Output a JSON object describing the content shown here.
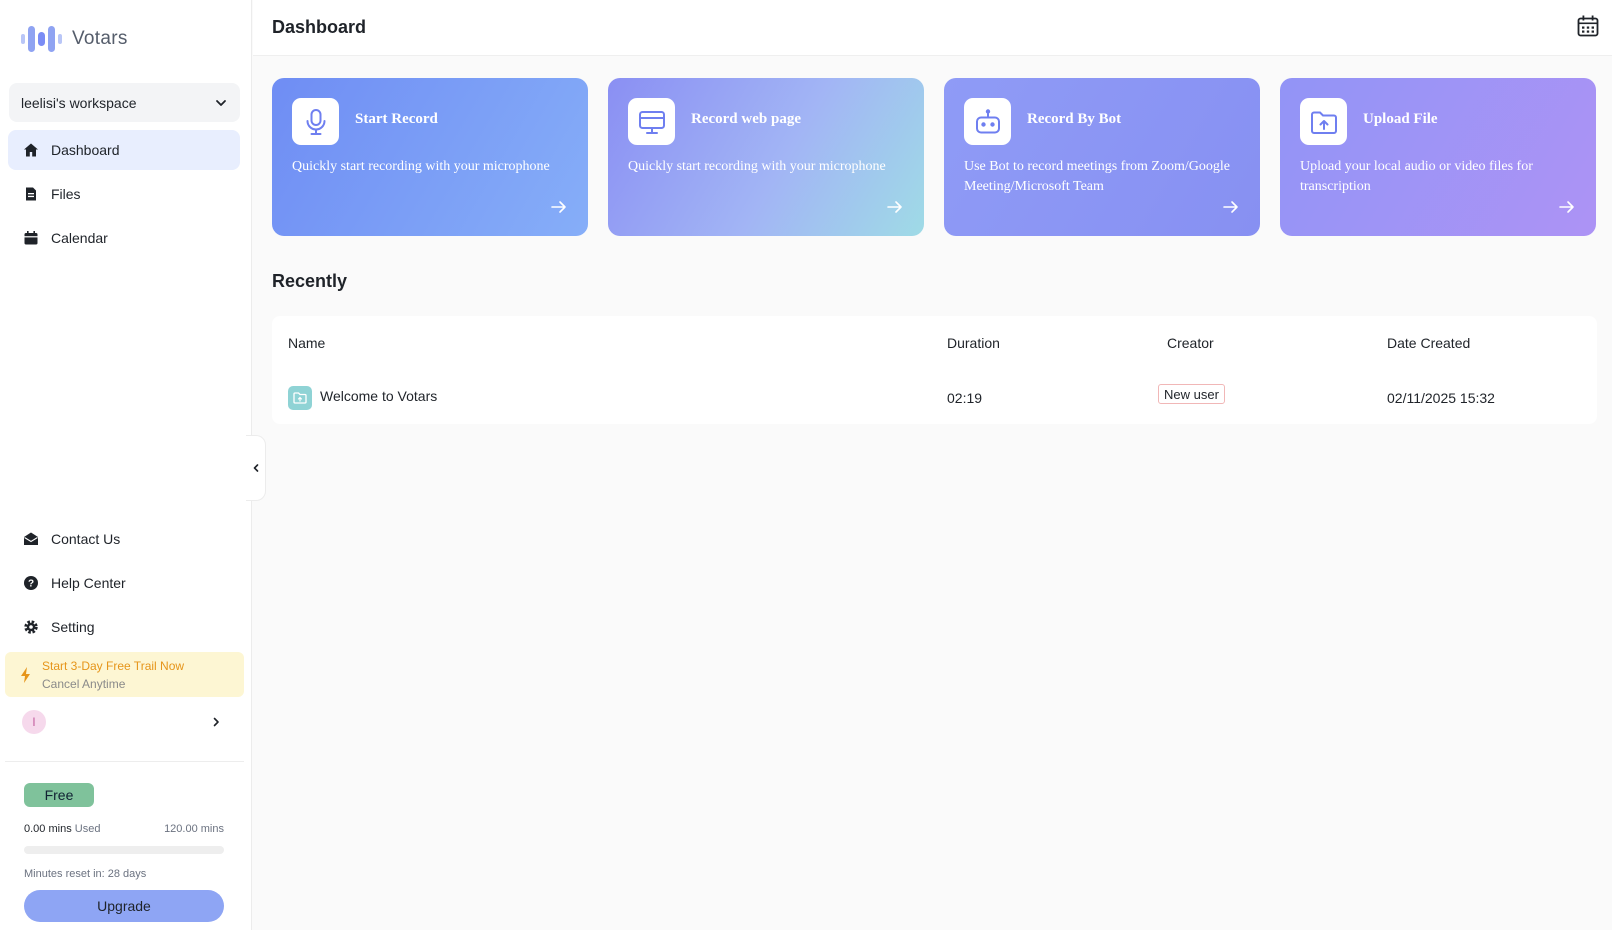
{
  "app": {
    "name": "Votars"
  },
  "sidebar": {
    "workspace": "leelisi's workspace",
    "nav": [
      {
        "label": "Dashboard",
        "icon": "home-icon",
        "active": true
      },
      {
        "label": "Files",
        "icon": "file-icon"
      },
      {
        "label": "Calendar",
        "icon": "calendar-icon"
      }
    ],
    "bottom_nav": [
      {
        "label": "Contact Us",
        "icon": "envelope-icon"
      },
      {
        "label": "Help Center",
        "icon": "help-icon"
      },
      {
        "label": "Setting",
        "icon": "gear-icon"
      }
    ],
    "trial": {
      "title": "Start 3-Day Free Trail Now",
      "subtitle": "Cancel Anytime"
    },
    "profile": {
      "initial": "l"
    },
    "plan": {
      "name": "Free",
      "used": "0.00 mins",
      "used_suffix": "Used",
      "total": "120.00 mins",
      "usage_fraction": 0.0,
      "reset_text": "Minutes reset in: 28 days",
      "upgrade_label": "Upgrade"
    }
  },
  "header": {
    "title": "Dashboard"
  },
  "cards": [
    {
      "title": "Start Record",
      "description": "Quickly start recording with your microphone",
      "icon": "microphone-icon"
    },
    {
      "title": "Record web page",
      "description": "Quickly start recording with your microphone",
      "icon": "monitor-icon"
    },
    {
      "title": "Record By Bot",
      "description": "Use Bot to record meetings from Zoom/Google Meeting/Microsoft Team",
      "icon": "robot-icon"
    },
    {
      "title": "Upload File",
      "description": "Upload your local audio or video files for transcription",
      "icon": "folder-upload-icon"
    }
  ],
  "recently": {
    "title": "Recently",
    "columns": [
      "Name",
      "Duration",
      "Creator",
      "Date Created"
    ],
    "rows": [
      {
        "name": "Welcome to Votars",
        "duration": "02:19",
        "creator": "New user",
        "date": "02/11/2025 15:32"
      }
    ]
  },
  "colors": {
    "accent": "#7a8cf5",
    "active_nav_bg": "#e8eefe",
    "trial_bg": "#fdf6d3",
    "trial_text": "#e6951a",
    "free_badge": "#7fc29b",
    "upgrade_button": "#8ea5f4"
  }
}
